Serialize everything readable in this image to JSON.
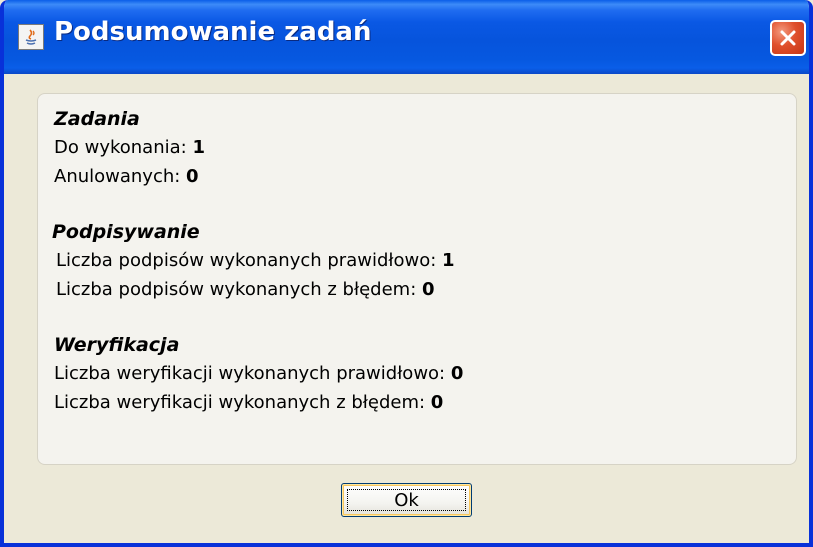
{
  "window": {
    "title": "Podsumowanie zadań",
    "icon": "java-icon",
    "close_icon": "close-icon"
  },
  "sections": [
    {
      "title": "Zadania",
      "rows": [
        {
          "label": "Do wykonania: ",
          "value": "1"
        },
        {
          "label": "Anulowanych: ",
          "value": "0"
        }
      ]
    },
    {
      "title": "Podpisywanie",
      "rows": [
        {
          "label": "Liczba podpisów wykonanych prawidłowo: ",
          "value": "1"
        },
        {
          "label": "Liczba podpisów wykonanych z błędem: ",
          "value": "0"
        }
      ]
    },
    {
      "title": "Weryfikacja",
      "rows": [
        {
          "label": "Liczba weryfikacji wykonanych prawidłowo: ",
          "value": "0"
        },
        {
          "label": "Liczba weryfikacji wykonanych z błędem: ",
          "value": "0"
        }
      ]
    }
  ],
  "buttons": {
    "ok_label": "Ok"
  },
  "colors": {
    "titlebar": "#0654dc",
    "close_button": "#e0502c",
    "window_bg": "#ece9d8",
    "panel_bg": "#f4f3ee"
  }
}
